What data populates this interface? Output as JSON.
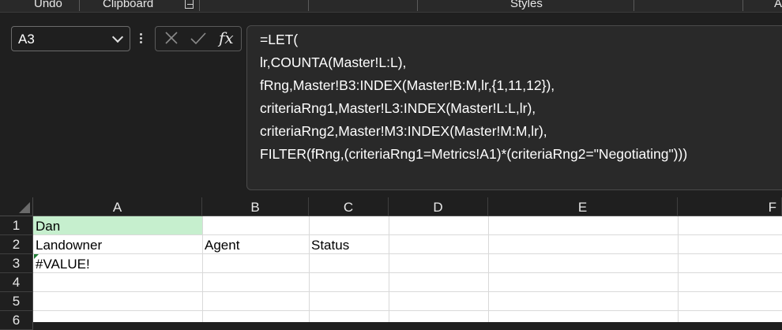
{
  "ribbon": {
    "groups": [
      "Undo",
      "Clipboard",
      "Styles",
      "A"
    ],
    "launcher_icon": "dialog-launcher-icon"
  },
  "formula_bar": {
    "name_box": "A3",
    "fx_label": "fx",
    "cancel_icon": "cancel-x-icon",
    "enter_icon": "checkmark-icon",
    "formula_lines": [
      "=LET(",
      "lr,COUNTA(Master!L:L),",
      "fRng,Master!B3:INDEX(Master!B:M,lr,{1,11,12}),",
      "criteriaRng1,Master!L3:INDEX(Master!L:L,lr),",
      "criteriaRng2,Master!M3:INDEX(Master!M:M,lr),",
      "FILTER(fRng,(criteriaRng1=Metrics!A1)*(criteriaRng2=\"Negotiating\")))"
    ]
  },
  "sheet": {
    "columns": [
      "A",
      "B",
      "C",
      "D",
      "E",
      "F"
    ],
    "rows": [
      "1",
      "2",
      "3",
      "4",
      "5",
      "6"
    ],
    "cells": {
      "A1": "Dan",
      "A2": "Landowner",
      "B2": "Agent",
      "C2": "Status",
      "A3": "#VALUE!"
    },
    "colors": {
      "highlight": "#c6efce",
      "error_indicator": "#1e7b34"
    }
  }
}
